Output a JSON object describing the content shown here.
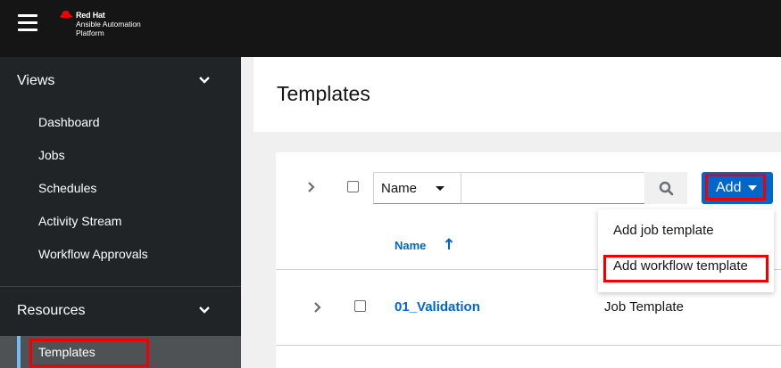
{
  "header": {
    "brand_name": "Red Hat",
    "brand_line1": "Ansible Automation",
    "brand_line2": "Platform",
    "menu_icon": "hamburger-menu-icon",
    "colors": {
      "bg": "#151515",
      "logo_red": "#ee0000"
    }
  },
  "sidebar": {
    "views": {
      "label": "Views",
      "items": [
        "Dashboard",
        "Jobs",
        "Schedules",
        "Activity Stream",
        "Workflow Approvals"
      ]
    },
    "resources": {
      "label": "Resources",
      "items": [
        "Templates"
      ],
      "active": "Templates"
    },
    "colors": {
      "bg": "#212427",
      "active_bg": "#4f5255",
      "active_bar": "#73bcf7"
    }
  },
  "page": {
    "title": "Templates"
  },
  "toolbar": {
    "filter_label": "Name",
    "search_value": "",
    "search_icon": "search-icon",
    "add_label": "Add",
    "add_menu": [
      "Add job template",
      "Add workflow template"
    ]
  },
  "table": {
    "columns": [
      {
        "label": "Name",
        "sorted": "ascending"
      }
    ],
    "rows": [
      {
        "name": "01_Validation",
        "type": "Job Template"
      }
    ]
  },
  "highlights": {
    "color": "#ee0000",
    "targets": [
      "Templates",
      "Add",
      "Add workflow template"
    ]
  },
  "colors": {
    "primary": "#0066cc",
    "link": "#0066cc"
  }
}
